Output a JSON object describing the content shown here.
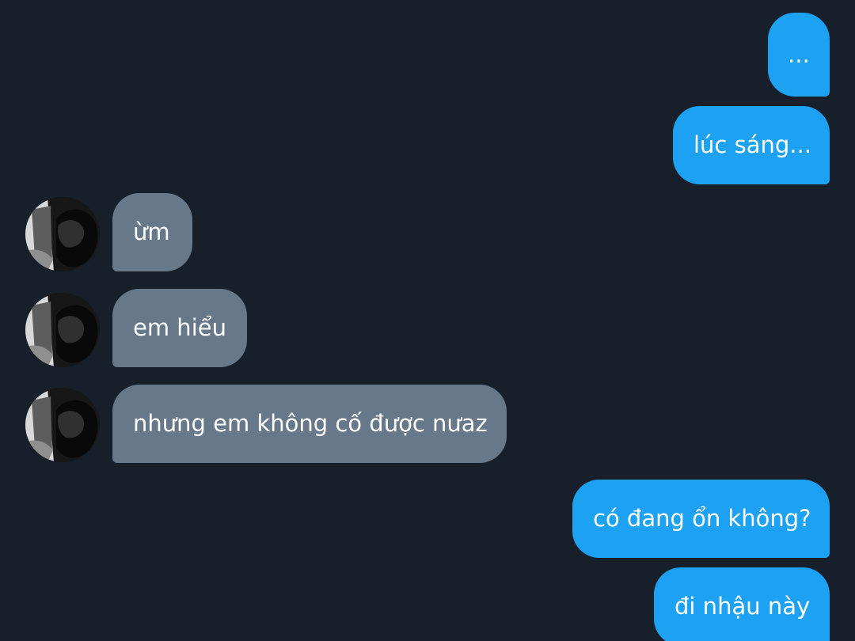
{
  "conversation": {
    "messages": [
      {
        "sender": "me",
        "text": "..."
      },
      {
        "sender": "me",
        "text": "lúc sáng..."
      },
      {
        "sender": "other",
        "text": "ừm"
      },
      {
        "sender": "other",
        "text": "em hiểu"
      },
      {
        "sender": "other",
        "text": "nhưng em không cố được nưaz"
      },
      {
        "sender": "me",
        "text": "có đang ổn không?"
      },
      {
        "sender": "me",
        "text": "đi nhậu này"
      }
    ]
  },
  "theme": {
    "background": "#17202a",
    "sent_bubble": "#1da1f2",
    "received_bubble": "#66788a",
    "text": "#ffffff"
  }
}
